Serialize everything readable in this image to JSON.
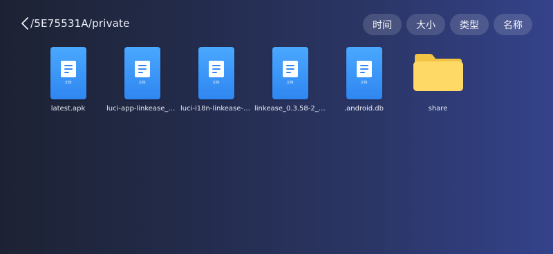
{
  "header": {
    "path": "/5E75531A/private",
    "back_icon": "chevron-left-icon"
  },
  "sort": {
    "buttons": [
      "时间",
      "大小",
      "类型",
      "名称"
    ]
  },
  "files": [
    {
      "name": "latest.apk",
      "type": "file",
      "type_caption": "文档"
    },
    {
      "name": "luci-app-linkease_2.1…",
      "type": "file",
      "type_caption": "文档"
    },
    {
      "name": "luci-i18n-linkease-zh-…",
      "type": "file",
      "type_caption": "文档"
    },
    {
      "name": "linkease_0.3.58-2_aar…",
      "type": "file",
      "type_caption": "文档"
    },
    {
      "name": ".android.db",
      "type": "file",
      "type_caption": "文档"
    },
    {
      "name": "share",
      "type": "folder"
    }
  ],
  "colors": {
    "file_blue": "#3a95f7",
    "folder_yellow": "#ffd966",
    "folder_tab": "#f3c443"
  }
}
